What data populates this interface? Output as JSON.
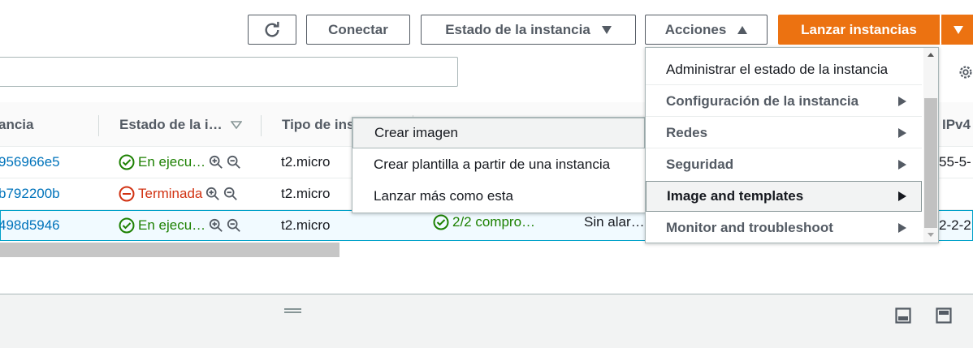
{
  "toolbar": {
    "refresh_icon": "refresh-icon",
    "connect_label": "Conectar",
    "instance_state_label": "Estado de la instancia",
    "actions_label": "Acciones",
    "launch_label": "Lanzar instancias",
    "accent": "#ec7211"
  },
  "search": {
    "placeholder": ""
  },
  "table": {
    "headers": [
      "ancia",
      "Estado de la i…",
      "Tipo de ins",
      "IPv4"
    ],
    "rows": [
      {
        "id": "956966e5",
        "state": "En ejecu…",
        "state_kind": "running",
        "type": "t2.micro",
        "check": "",
        "alarm": "",
        "ipv4": "55-5-"
      },
      {
        "id": "b792200b",
        "state": "Terminada",
        "state_kind": "terminated",
        "type": "t2.micro",
        "check": "",
        "alarm": "",
        "ipv4": ""
      },
      {
        "id": "498d5946",
        "state": "En ejecu…",
        "state_kind": "running",
        "type": "t2.micro",
        "check": "2/2 compro…",
        "alarm": "Sin alar…",
        "ipv4": "2-2-2"
      }
    ]
  },
  "actions_menu": {
    "items": [
      {
        "label": "Administrar el estado de la instancia",
        "submenu": false,
        "bold": false
      },
      {
        "label": "Configuración de la instancia",
        "submenu": true,
        "bold": true
      },
      {
        "label": "Redes",
        "submenu": true,
        "bold": true
      },
      {
        "label": "Seguridad",
        "submenu": true,
        "bold": true
      },
      {
        "label": "Image and templates",
        "submenu": true,
        "bold": true,
        "active": true
      },
      {
        "label": "Monitor and troubleshoot",
        "submenu": true,
        "bold": true
      }
    ]
  },
  "submenu": {
    "items": [
      "Crear imagen",
      "Crear plantilla a partir de una instancia",
      "Lanzar más como esta"
    ]
  },
  "colors": {
    "link": "#0073bb",
    "ok": "#1d8102",
    "error": "#d13212"
  }
}
